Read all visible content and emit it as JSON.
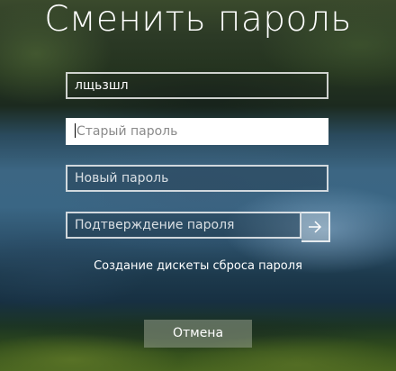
{
  "title": "Сменить пароль",
  "username_field": {
    "value": "лщьзшл"
  },
  "old_password_field": {
    "placeholder": "Старый пароль"
  },
  "new_password_field": {
    "placeholder": "Новый пароль"
  },
  "confirm_password_field": {
    "placeholder": "Подтверждение пароля"
  },
  "submit_button": {
    "icon": "arrow-right-icon"
  },
  "reset_disk_link": "Создание дискеты сброса пароля",
  "cancel_button": "Отмена"
}
